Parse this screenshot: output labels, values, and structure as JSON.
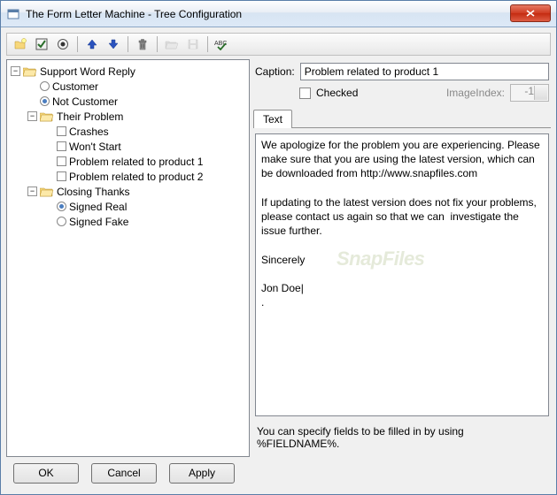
{
  "window": {
    "title": "The Form Letter Machine - Tree Configuration"
  },
  "toolbar": {
    "items": [
      "new",
      "check",
      "target",
      "",
      "up",
      "down",
      "",
      "delete",
      "",
      "open",
      "save",
      "",
      "spell"
    ]
  },
  "tree": {
    "root": {
      "label": "Support Word Reply",
      "expanded": true,
      "children": [
        {
          "type": "radio",
          "label": "Customer",
          "checked": false
        },
        {
          "type": "radio",
          "label": "Not Customer",
          "checked": true
        },
        {
          "type": "folder",
          "label": "Their Problem",
          "expanded": true,
          "children": [
            {
              "type": "check",
              "label": "Crashes"
            },
            {
              "type": "check",
              "label": "Won't Start"
            },
            {
              "type": "check",
              "label": "Problem related to product 1"
            },
            {
              "type": "check",
              "label": "Problem related to product 2"
            }
          ]
        },
        {
          "type": "folder",
          "label": "Closing Thanks",
          "expanded": true,
          "children": [
            {
              "type": "radio",
              "label": "Signed Real",
              "checked": true
            },
            {
              "type": "radio",
              "label": "Signed Fake",
              "checked": false
            }
          ]
        }
      ]
    }
  },
  "details": {
    "caption_label": "Caption:",
    "caption_value": "Problem related to product 1",
    "checked_label": "Checked",
    "checked_value": false,
    "imageindex_label": "ImageIndex:",
    "imageindex_value": "-1",
    "tab_text": "Text",
    "body": "We apologize for the problem you are experiencing. Please make sure that you are using the latest version, which can be downloaded from http://www.snapfiles.com\n\nIf updating to the latest version does not fix your problems, please contact us again so that we can  investigate the issue further.\n\nSincerely\n\nJon Doe|\n.",
    "hint": "You can specify fields to be filled in by using %FIELDNAME%."
  },
  "buttons": {
    "ok": "OK",
    "cancel": "Cancel",
    "apply": "Apply"
  },
  "watermark": "SnapFiles"
}
